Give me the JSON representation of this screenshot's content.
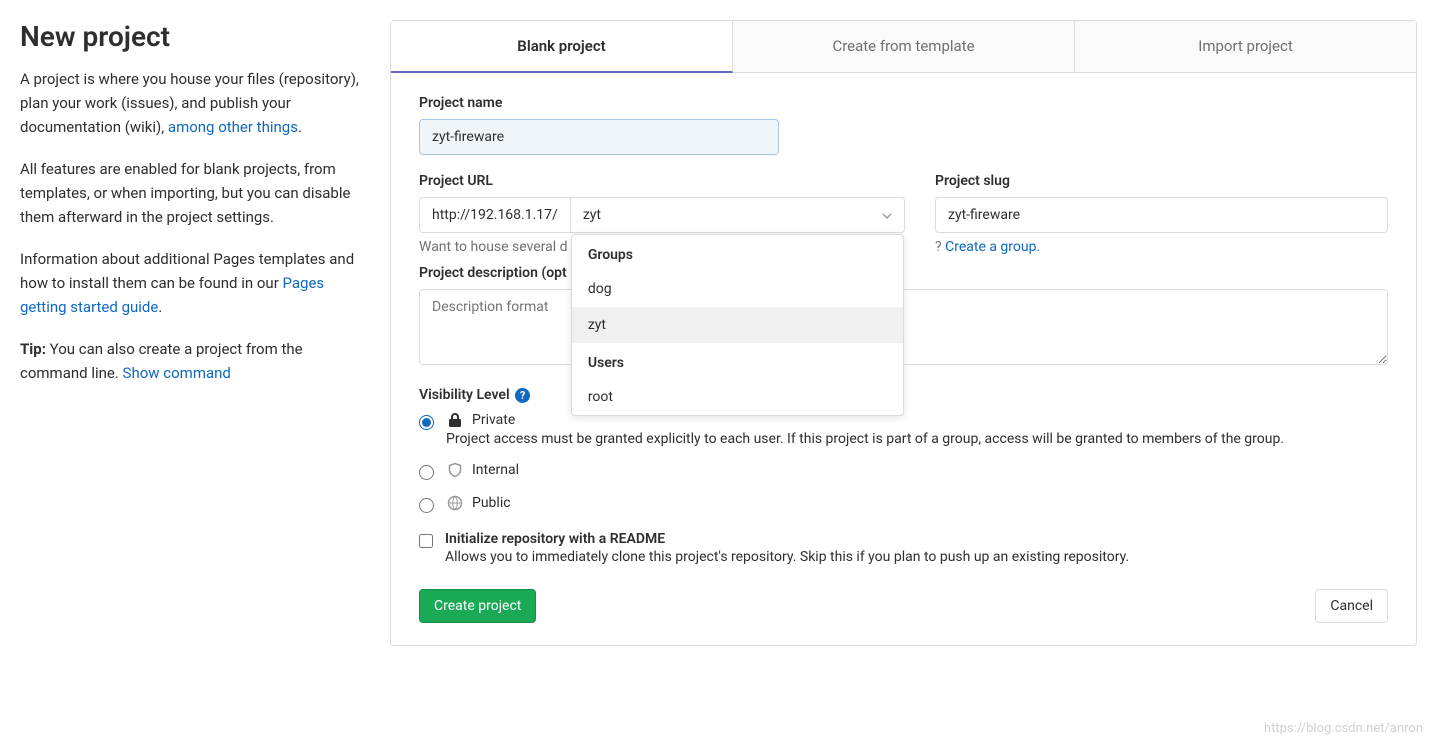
{
  "header": {
    "title": "New project"
  },
  "sidebar": {
    "p1_prefix": "A project is where you house your files (repository), plan your work (issues), and publish your documentation (wiki), ",
    "p1_link": "among other things",
    "p1_suffix": ".",
    "p2": "All features are enabled for blank projects, from templates, or when importing, but you can disable them afterward in the project settings.",
    "p3_prefix": "Information about additional Pages templates and how to install them can be found in our ",
    "p3_link": "Pages getting started guide",
    "p3_suffix": ".",
    "tip_label": "Tip:",
    "tip_text": " You can also create a project from the command line. ",
    "tip_link": "Show command"
  },
  "tabs": {
    "blank": "Blank project",
    "template": "Create from template",
    "import": "Import project"
  },
  "form": {
    "project_name_label": "Project name",
    "project_name_value": "zyt-fireware",
    "project_url_label": "Project URL",
    "project_url_prefix": "http://192.168.1.17/",
    "namespace_value": "zyt",
    "project_slug_label": "Project slug",
    "project_slug_value": "zyt-fireware",
    "group_hint_prefix": "Want to house several d",
    "group_hint_suffix": "? ",
    "group_hint_link": "Create a group.",
    "description_label": "Project description (opt",
    "description_placeholder": "Description format",
    "visibility_label": "Visibility Level",
    "visibility": {
      "private": {
        "title": "Private",
        "desc": "Project access must be granted explicitly to each user. If this project is part of a group, access will be granted to members of the group."
      },
      "internal": {
        "title": "Internal"
      },
      "public": {
        "title": "Public"
      }
    },
    "readme": {
      "title": "Initialize repository with a README",
      "desc": "Allows you to immediately clone this project's repository. Skip this if you plan to push up an existing repository."
    },
    "submit": "Create project",
    "cancel": "Cancel"
  },
  "dropdown": {
    "groups_header": "Groups",
    "users_header": "Users",
    "groups": [
      "dog",
      "zyt"
    ],
    "users": [
      "root"
    ],
    "selected": "zyt"
  },
  "watermark": "https://blog.csdn.net/anron"
}
